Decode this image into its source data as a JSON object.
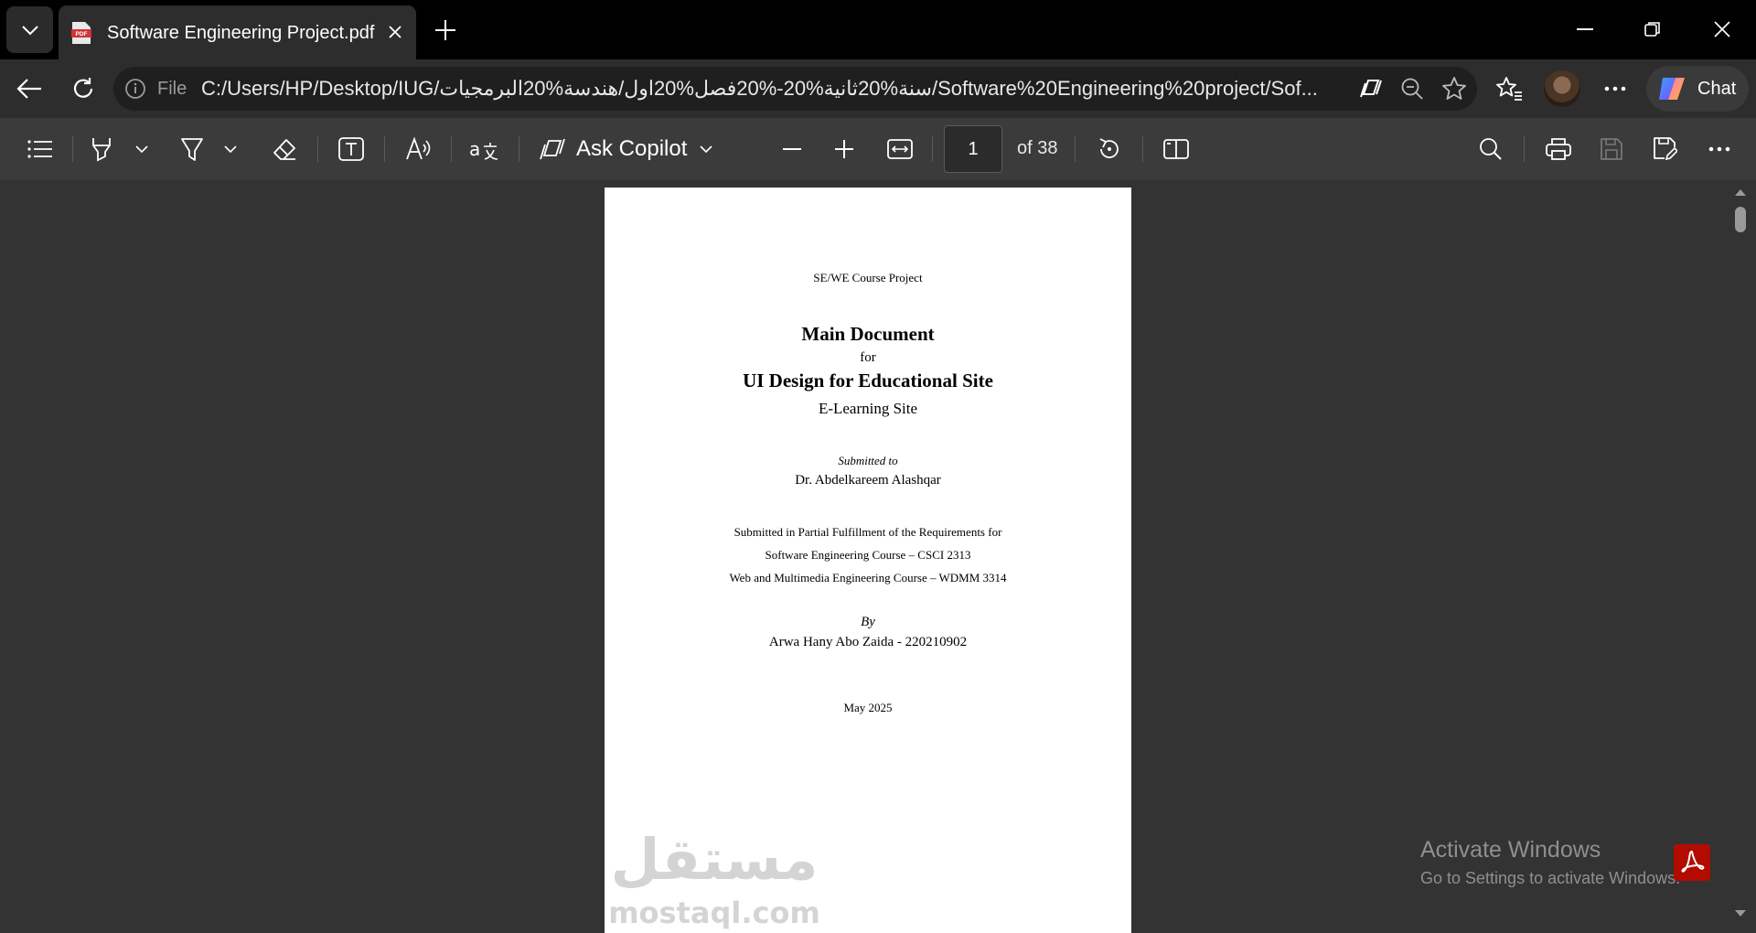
{
  "tab": {
    "title": "Software Engineering Project.pdf"
  },
  "address": {
    "scheme_label": "File",
    "url": "C:/Users/HP/Desktop/IUG/سنة%20ثانية%20-%20فصل%20اول/هندسة%20البرمجيات/Software%20Engineering%20project/Sof..."
  },
  "sidebar_chat": {
    "label": "Chat"
  },
  "pdf_toolbar": {
    "ask_copilot_label": "Ask Copilot",
    "page_number": "1",
    "page_total_label": "of 38"
  },
  "document": {
    "header": "SE/WE Course Project",
    "title": "Main Document",
    "for": "for",
    "subject": "UI Design for Educational Site",
    "subtitle": "E-Learning Site",
    "submitted_to_label": "Submitted to",
    "submitted_to": "Dr. Abdelkareem Alashqar",
    "fulfillment_line1": "Submitted in Partial Fulfillment of the Requirements for",
    "fulfillment_line2": "Software Engineering Course – CSCI 2313",
    "fulfillment_line3": "Web and Multimedia Engineering Course – WDMM 3314",
    "by_label": "By",
    "author": "Arwa Hany Abo Zaida - 220210902",
    "date": "May 2025"
  },
  "watermark": {
    "arabic": "مستقل",
    "latin": "mostaql.com"
  },
  "os_overlay": {
    "activate_title": "Activate Windows",
    "activate_hint": "Go to Settings to activate Windows."
  }
}
